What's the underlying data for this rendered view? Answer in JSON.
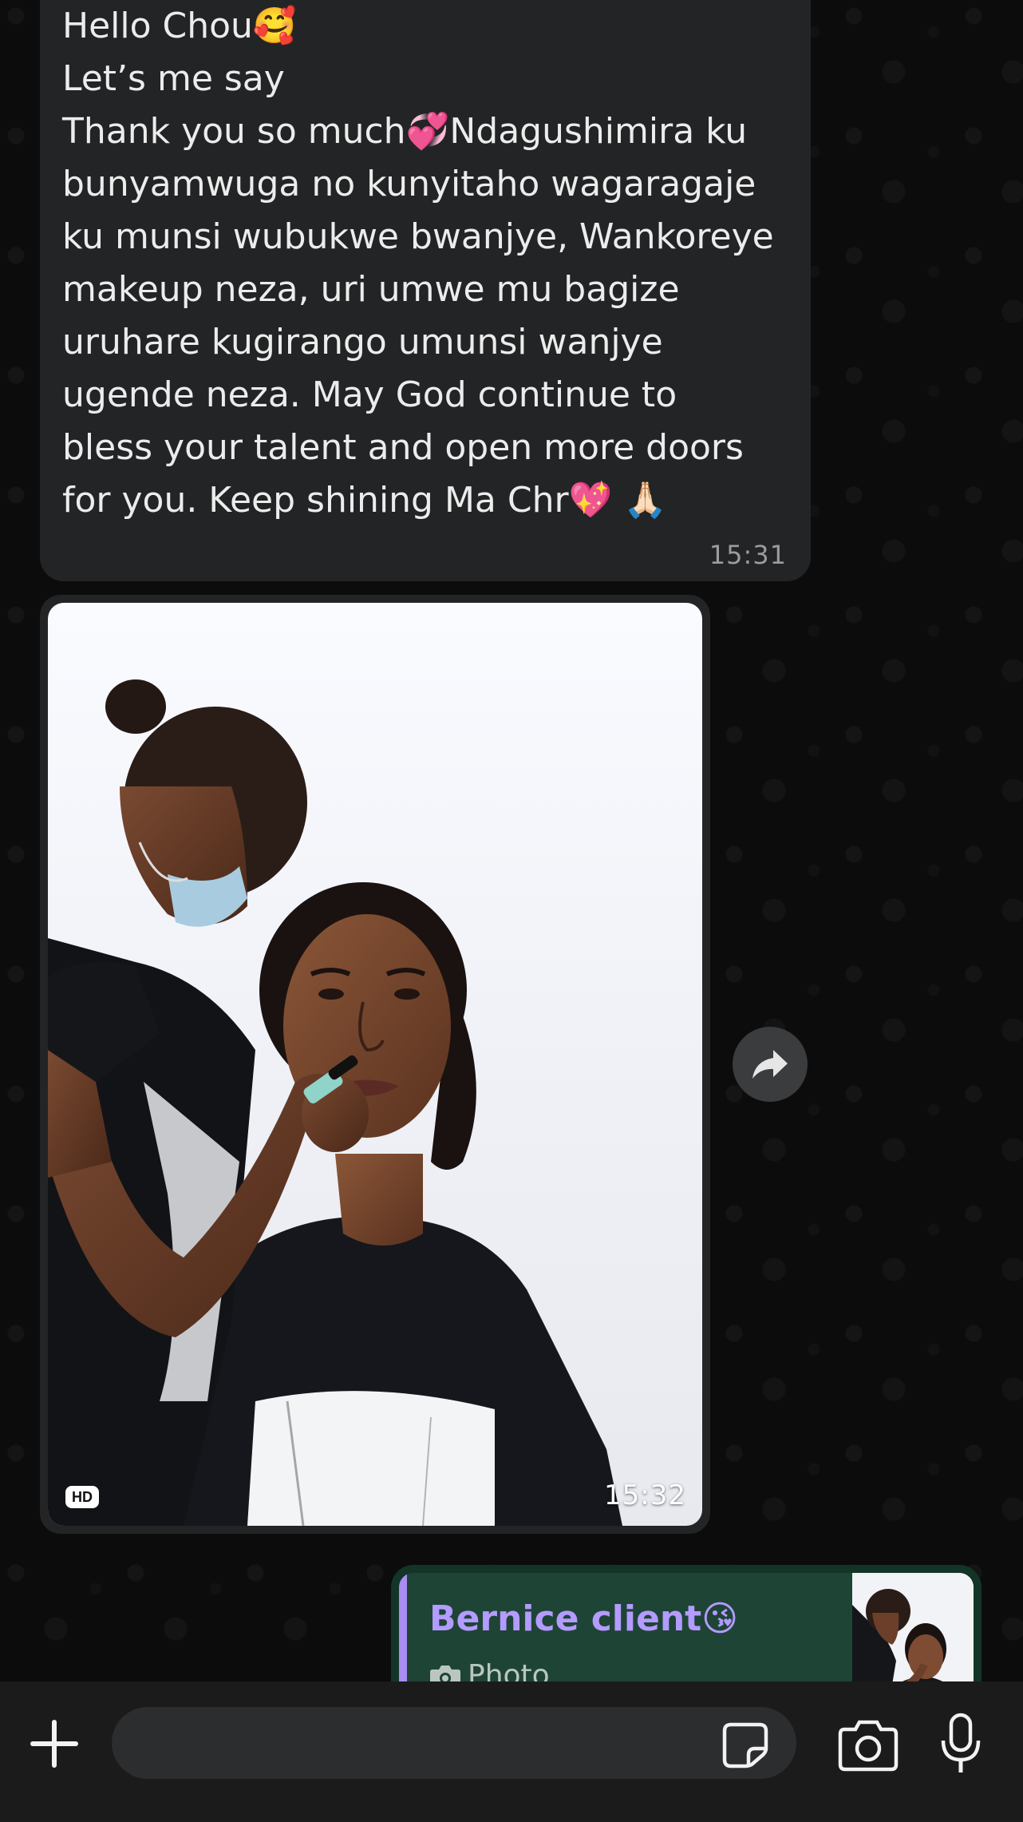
{
  "incoming_message": {
    "lines": [
      "Hello Chou🥰",
      "Let’s me say",
      "Thank you so much💞Ndagushimira ku",
      "bunyamwuga no kunyitaho wagaragaje",
      "ku munsi wubukwe bwanjye, Wankoreye",
      "makeup neza, uri umwe mu bagize",
      "uruhare kugirango umunsi wanjye",
      "ugende neza. May God continue to",
      "bless your talent and open more doors",
      "for you. Keep shining Ma Chr💖 🙏🏻"
    ],
    "time": "15:31"
  },
  "image_message": {
    "badge": "HD",
    "time": "15:32",
    "description_icon": "photo-makeup-artist"
  },
  "forward_button": {
    "icon": "forward-arrow-icon"
  },
  "outgoing_reply": {
    "quoted_name": "Bernice client😘",
    "quoted_type": "Photo",
    "quoted_icon": "camera-icon",
    "accent_color": "#a98df2"
  },
  "input_bar": {
    "value": "",
    "icons": [
      "plus-icon",
      "sticker-icon",
      "camera-icon",
      "microphone-icon"
    ]
  },
  "colors": {
    "background": "#0c0c0c",
    "incoming_bubble": "#232425",
    "outgoing_bubble": "#123528",
    "quote_background": "#1e4436",
    "text": "#ececec",
    "timestamp": "#9a9c9e"
  }
}
